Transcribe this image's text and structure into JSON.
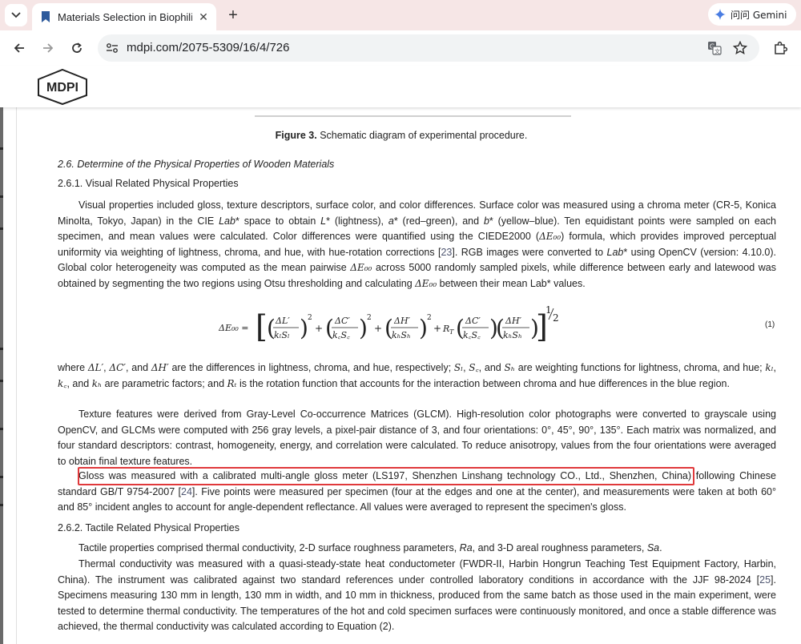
{
  "browser": {
    "tab": {
      "title": "Materials Selection in Biophilic",
      "close_glyph": "✕"
    },
    "new_tab_glyph": "+",
    "gemini_label": "问问 Gemini",
    "url": "mdpi.com/2075-5309/16/4/726"
  },
  "site": {
    "logo_text": "MDPI"
  },
  "figure_caption": {
    "label": "Figure 3.",
    "text": " Schematic diagram of experimental procedure."
  },
  "section": {
    "heading": "2.6. Determine of the Physical Properties of Wooden Materials",
    "sub1": "2.6.1. Visual Related Physical Properties",
    "sub2": "2.6.2. Tactile Related Physical Properties"
  },
  "visual_para": {
    "s1": "Visual properties included gloss, texture descriptors, surface color, and color differences. Surface color was measured using a chroma meter (CR-5, Konica Minolta, Tokyo, Japan) in the CIE ",
    "lab": "Lab",
    "s2": "* space to obtain ",
    "L": "L",
    "s3": "* (lightness), ",
    "a": "a",
    "s4": "* (red–green), and ",
    "b": "b",
    "s5": "* (yellow–blue). Ten equidistant points were sampled on each specimen, and mean values were calculated. Color differences were quantified using the CIEDE2000 (",
    "de00_a": "ΔE₀₀",
    "s6": ") formula, which provides improved perceptual uniformity via weighting of lightness, chroma, and hue, with hue-rotation corrections [",
    "ref23": "23",
    "s7": "]. RGB images were converted to ",
    "lab2": "Lab",
    "s8": "* using OpenCV (version: 4.10.0). Global color heterogeneity was computed as the mean pairwise ",
    "de00_b": "ΔE₀₀",
    "s9": " across 5000 randomly sampled pixels, while difference between early and latewood was obtained by segmenting the two regions using Otsu thresholding and calculating ",
    "de00_c": "ΔE₀₀",
    "s10": " between their mean Lab* values."
  },
  "equation": {
    "number": "(1)",
    "lhs": "ΔE₀₀ =",
    "t1_num": "ΔL′",
    "t1_den": "kₗSₗ",
    "t2_num": "ΔC′",
    "t2_den": "k꜀S꜀",
    "t3_num": "ΔH′",
    "t3_den": "kₕSₕ",
    "rt": "R",
    "rt_sub": "T",
    "sq": "2",
    "exp_num": "1",
    "exp_den": "2"
  },
  "where_para": {
    "s1": "where ",
    "dL": "ΔL′",
    "s2": ", ",
    "dC": "ΔC′",
    "s3": ", and ",
    "dH": "ΔH′",
    "s4": " are the differences in lightness, chroma, and hue, respectively; ",
    "SL": "Sₗ",
    "s5": ", ",
    "SC": "S꜀",
    "s6": ", and ",
    "SH": "Sₕ",
    "s7": " are weighting functions for lightness, chroma, and hue; ",
    "kL": "kₗ",
    "s8": ", ",
    "kC": "k꜀",
    "s9": ", and ",
    "kH": "kₕ",
    "s10": " are parametric factors; and ",
    "RT": "Rₜ",
    "s11": " is the rotation function that accounts for the interaction between chroma and hue differences in the blue region."
  },
  "texture_para": "Texture features were derived from Gray-Level Co-occurrence Matrices (GLCM). High-resolution color photographs were converted to grayscale using OpenCV, and GLCMs were computed with 256 gray levels, a pixel-pair distance of 3, and four orientations: 0°, 45°, 90°, 135°. Each matrix was normalized, and four standard descriptors: contrast, homogeneity, energy, and correlation were calculated. To reduce anisotropy, values from the four orientations were averaged to obtain final texture features.",
  "gloss_para": {
    "s1": "Gloss was measured with a calibrated multi-angle gloss meter (LS197, Shenzhen Linshang technology CO., Ltd., Shenzhen, China) following Chinese standard GB/T 9754-2007 [",
    "ref24": "24",
    "s2": "]. Five points were measured per specimen (four at the edges and one at the center), and measurements were taken at both 60° and 85° incident angles to account for angle-dependent reflectance. All values were averaged to represent the specimen's gloss."
  },
  "tactile_para1": {
    "s1": "Tactile properties comprised thermal conductivity, 2-D surface roughness parameters, ",
    "ra": "Ra",
    "s2": ", and 3-D areal roughness parameters, ",
    "sa": "Sa",
    "s3": "."
  },
  "tactile_para2": {
    "s1": "Thermal conductivity was measured with a quasi-steady-state heat conductometer (FWDR-II, Harbin Hongrun Teaching Test Equipment Factory, Harbin, China). The instrument was calibrated against two standard references under controlled laboratory conditions in accordance with the JJF 98-2024 [",
    "ref25": "25",
    "s2": "]. Specimens measuring 130 mm in length, 130 mm in width, and 10 mm in thickness, produced from the same batch as those used in the main experiment, were tested to determine thermal conductivity. The temperatures of the hot and cold specimen surfaces were continuously monitored, and once a stable difference was achieved, the thermal conductivity was calculated according to Equation (2)."
  },
  "colors": {
    "highlight": "#e0393b",
    "link": "#4f5671",
    "tabstrip": "#f6e6e6"
  },
  "icons": [
    "tab-list-icon",
    "favicon-bookmark-icon",
    "close-icon",
    "new-tab-icon",
    "gemini-icon",
    "back-icon",
    "forward-icon",
    "reload-icon",
    "site-info-icon",
    "translate-icon",
    "bookmark-star-icon",
    "extensions-icon"
  ]
}
